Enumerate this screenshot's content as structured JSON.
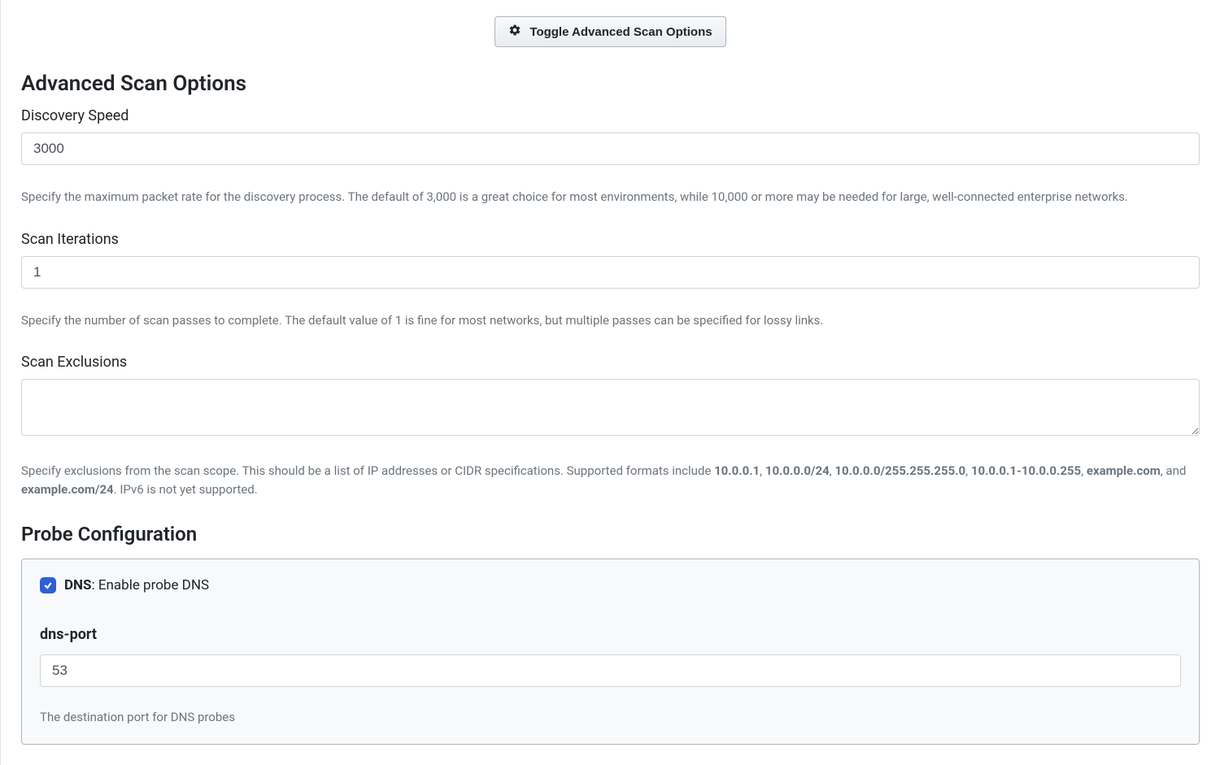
{
  "toggle_button_label": "Toggle Advanced Scan Options",
  "section_title": "Advanced Scan Options",
  "discovery_speed": {
    "label": "Discovery Speed",
    "value": "3000",
    "help": "Specify the maximum packet rate for the discovery process. The default of 3,000 is a great choice for most environments, while 10,000 or more may be needed for large, well-connected enterprise networks."
  },
  "scan_iterations": {
    "label": "Scan Iterations",
    "value": "1",
    "help": "Specify the number of scan passes to complete. The default value of 1 is fine for most networks, but multiple passes can be specified for lossy links."
  },
  "scan_exclusions": {
    "label": "Scan Exclusions",
    "value": "",
    "help_pre": "Specify exclusions from the scan scope. This should be a list of IP addresses or CIDR specifications. Supported formats include ",
    "fmt1": "10.0.0.1",
    "sep1": ", ",
    "fmt2": "10.0.0.0/24",
    "sep2": ", ",
    "fmt3": "10.0.0.0/255.255.255.0",
    "sep3": ", ",
    "fmt4": "10.0.0.1-10.0.0.255",
    "sep4": ", ",
    "fmt5": "example.com",
    "sep5": ", and ",
    "fmt6": "example.com/24",
    "help_post": ". IPv6 is not yet supported."
  },
  "probe_config": {
    "title": "Probe Configuration",
    "dns": {
      "checked": true,
      "name": "DNS",
      "desc": ": Enable probe DNS",
      "port_label": "dns-port",
      "port_value": "53",
      "port_help": "The destination port for DNS probes"
    }
  }
}
